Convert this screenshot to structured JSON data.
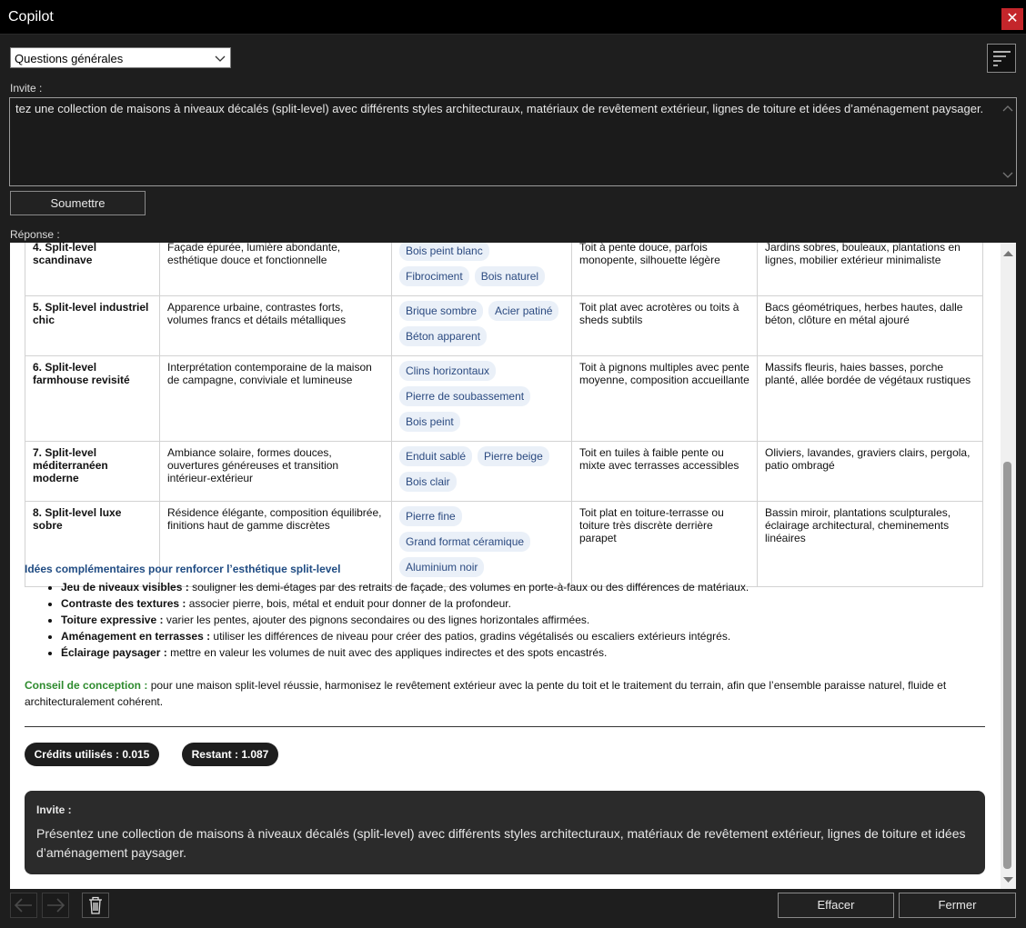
{
  "window": {
    "title": "Copilot",
    "close_glyph": "✕"
  },
  "mode": {
    "selected": "Questions générales"
  },
  "prompt": {
    "label": "Invite :",
    "value": "tez une collection de maisons à niveaux décalés (split-level) avec différents styles architecturaux, matériaux de revêtement extérieur, lignes de toiture et idées d’aménagement paysager."
  },
  "submit_label": "Soumettre",
  "response_label": "Réponse :",
  "table": {
    "rows": [
      {
        "style": "4. Split-level scandinave",
        "description": "Façade épurée, lumière abondante, esthétique douce et fonctionnelle",
        "materials": [
          "Bois peint blanc",
          "Fibrociment",
          "Bois naturel"
        ],
        "roof": "Toit à pente douce, parfois monopente, silhouette légère",
        "landscape": "Jardins sobres, bouleaux, plantations en lignes, mobilier extérieur minimaliste"
      },
      {
        "style": "5. Split-level industriel chic",
        "description": "Apparence urbaine, contrastes forts, volumes francs et détails métalliques",
        "materials": [
          "Brique sombre",
          "Acier patiné",
          "Béton apparent"
        ],
        "roof": "Toit plat avec acrotères ou toits à sheds subtils",
        "landscape": "Bacs géométriques, herbes hautes, dalle béton, clôture en métal ajouré"
      },
      {
        "style": "6. Split-level farmhouse revisité",
        "description": "Interprétation contemporaine de la maison de campagne, conviviale et lumineuse",
        "materials": [
          "Clins horizontaux",
          "Pierre de soubassement",
          "Bois peint"
        ],
        "roof": "Toit à pignons multiples avec pente moyenne, composition accueillante",
        "landscape": "Massifs fleuris, haies basses, porche planté, allée bordée de végétaux rustiques"
      },
      {
        "style": "7. Split-level méditerranéen moderne",
        "description": "Ambiance solaire, formes douces, ouvertures généreuses et transition intérieur-extérieur",
        "materials": [
          "Enduit sablé",
          "Pierre beige",
          "Bois clair"
        ],
        "roof": "Toit en tuiles à faible pente ou mixte avec terrasses accessibles",
        "landscape": "Oliviers, lavandes, graviers clairs, pergola, patio ombragé"
      },
      {
        "style": "8. Split-level luxe sobre",
        "description": "Résidence élégante, composition équilibrée, finitions haut de gamme discrètes",
        "materials": [
          "Pierre fine",
          "Grand format céramique",
          "Aluminium noir"
        ],
        "roof": "Toit plat en toiture-terrasse ou toiture très discrète derrière parapet",
        "landscape": "Bassin miroir, plantations sculpturales, éclairage architectural, cheminements linéaires"
      }
    ]
  },
  "ideas": {
    "title": "Idées complémentaires pour renforcer l’esthétique split-level",
    "items": [
      {
        "bold": "Jeu de niveaux visibles :",
        "text": " souligner les demi-étages par des retraits de façade, des volumes en porte-à-faux ou des différences de matériaux."
      },
      {
        "bold": "Contraste des textures :",
        "text": " associer pierre, bois, métal et enduit pour donner de la profondeur."
      },
      {
        "bold": "Toiture expressive :",
        "text": " varier les pentes, ajouter des pignons secondaires ou des lignes horizontales affirmées."
      },
      {
        "bold": "Aménagement en terrasses :",
        "text": " utiliser les différences de niveau pour créer des patios, gradins végétalisés ou escaliers extérieurs intégrés."
      },
      {
        "bold": "Éclairage paysager :",
        "text": " mettre en valeur les volumes de nuit avec des appliques indirectes et des spots encastrés."
      }
    ]
  },
  "advice": {
    "bold": "Conseil de conception :",
    "text": " pour une maison split-level réussie, harmonisez le revêtement extérieur avec la pente du toit et le traitement du terrain, afin que l’ensemble paraisse naturel, fluide et architecturalement cohérent."
  },
  "credits": {
    "used": "Crédits utilisés : 0.015",
    "remaining": "Restant : 1.087"
  },
  "echo": {
    "label": "Invite :",
    "text": "Présentez une collection de maisons à niveaux décalés (split-level) avec différents styles architecturaux, matériaux de revêtement extérieur, lignes de toiture et idées d’aménagement paysager."
  },
  "footer": {
    "clear_label": "Effacer",
    "close_label": "Fermer"
  },
  "colors": {
    "accent_blue": "#1f4b82",
    "advice_green": "#2e8b2e",
    "close_red": "#c4262b"
  }
}
